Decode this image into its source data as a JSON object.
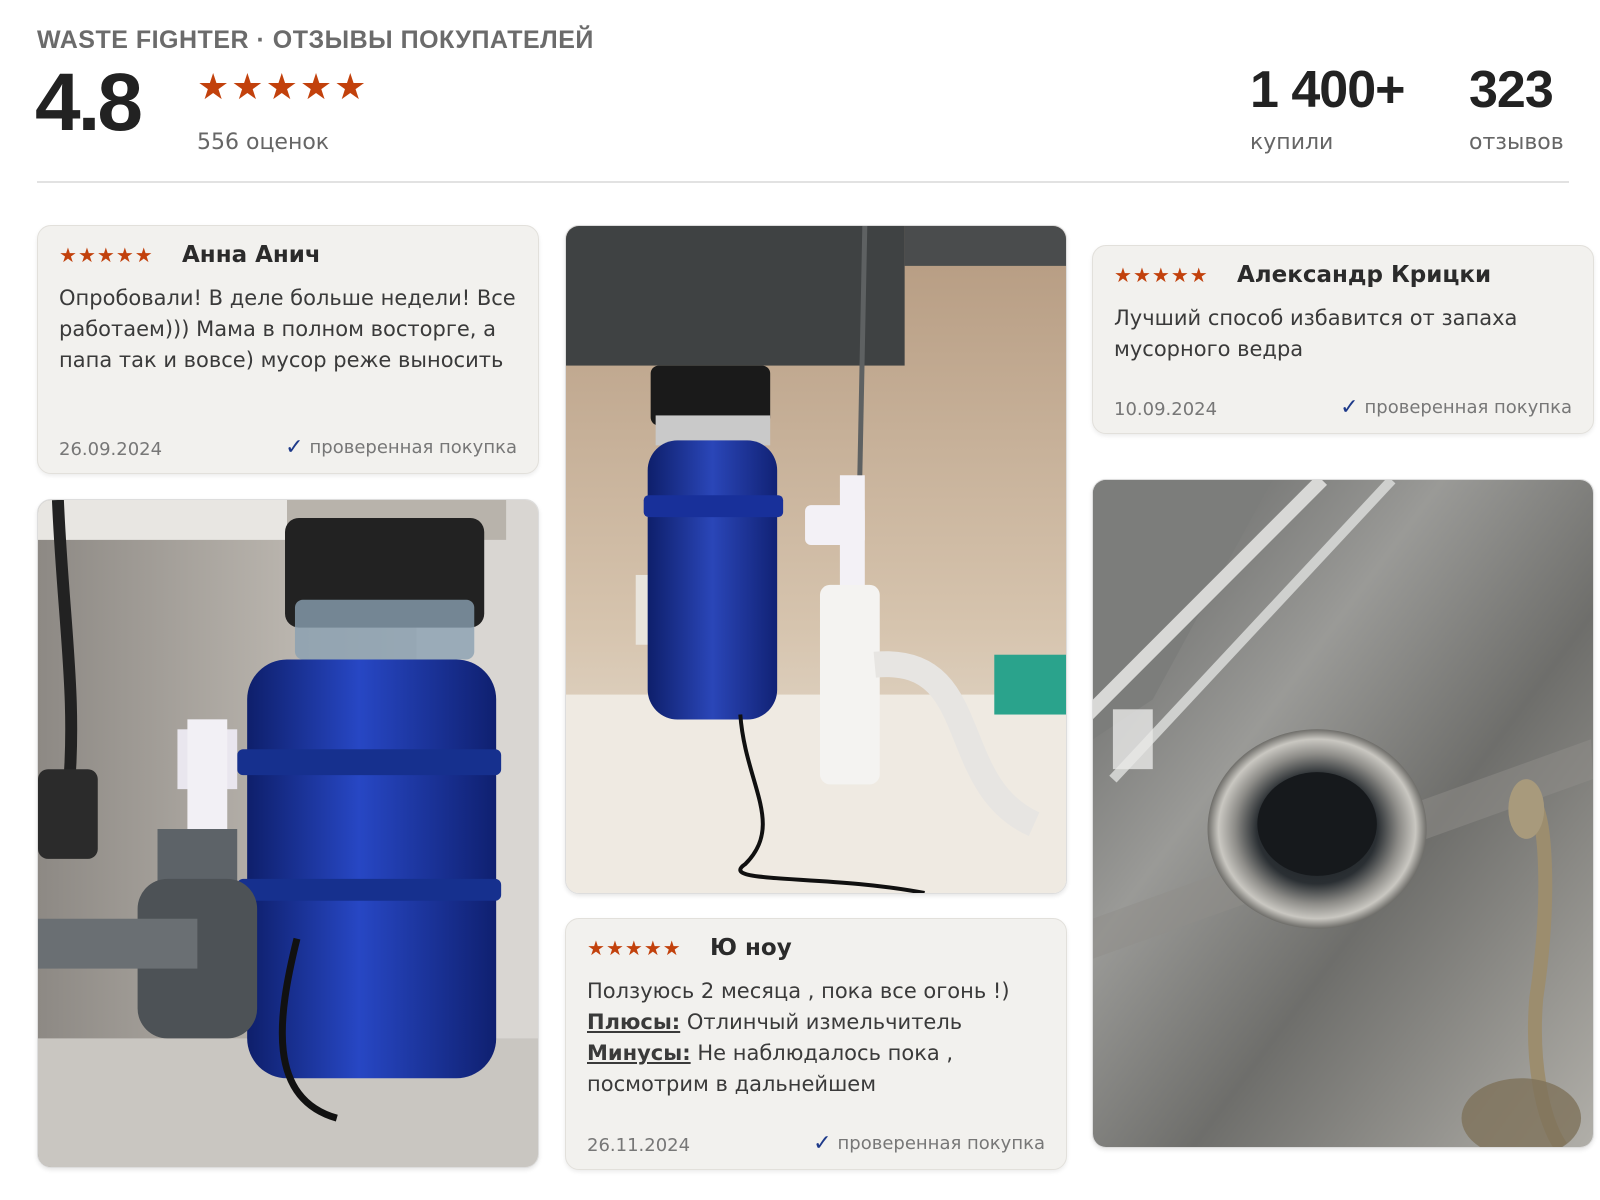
{
  "header": {
    "brand": "WASTE FIGHTER · ОТЗЫВЫ ПОКУПАТЕЛЕЙ",
    "rating": "4.8",
    "rating_stars": 5,
    "ratings_count": "556 оценок",
    "bought": {
      "value": "1 400+",
      "label": "купили"
    },
    "reviews": {
      "value": "323",
      "label": "отзывов"
    }
  },
  "reviews": [
    {
      "author": "Анна Анич",
      "stars": 5,
      "text": "Опробовали! В деле больше недели! Все работаем))) Мама в полном восторге, а папа так и вовсе) мусор реже выносить",
      "date": "26.09.2024",
      "verified": "проверенная покупка"
    },
    {
      "author": "Александр Крицки",
      "stars": 5,
      "text": "Лучший способ избавится от запаха мусорного ведра",
      "date": "10.09.2024",
      "verified": "проверенная покупка"
    },
    {
      "author": "Ю ноу",
      "stars": 5,
      "text": "Ползуюсь 2 месяца , пока все огонь !)",
      "pros_label": "Плюсы:",
      "pros": " Отлинчый измельчитель",
      "cons_label": "Минусы:",
      "cons": " Не наблюдалось пока , посмотрим в дальнейшем",
      "date": "26.11.2024",
      "verified": "проверенная покупка"
    }
  ],
  "photos": {
    "left": "blue-disposer-under-sink",
    "middle": "disposer-with-white-pipes",
    "right": "sink-drain-flange-engraving"
  },
  "colors": {
    "star": "#c2410c",
    "check": "#1e3a8a",
    "card_bg": "#f2f1ee",
    "disposer_blue": "#1f3a9e"
  }
}
